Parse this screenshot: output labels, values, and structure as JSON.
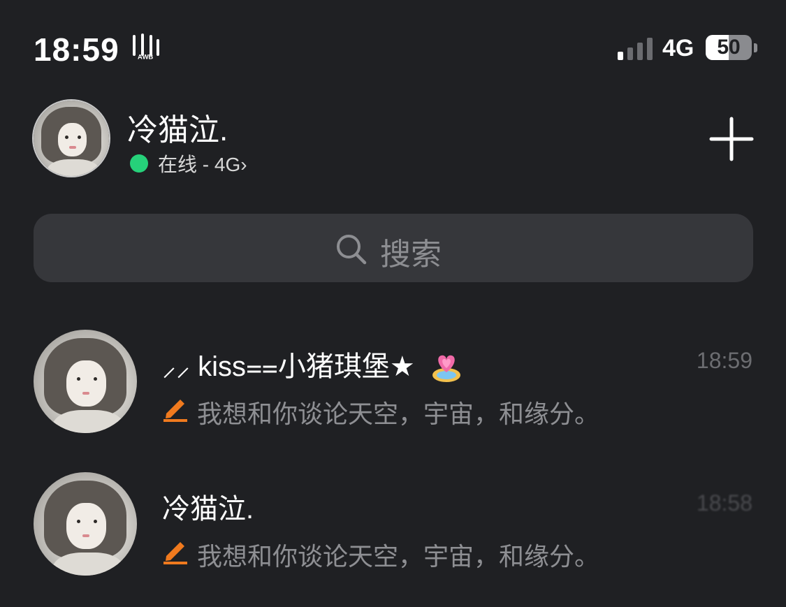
{
  "status_bar": {
    "time": "18:59",
    "network": "4G",
    "battery": "50",
    "battery_level": 50,
    "signal_bars": 1,
    "extra_icon": "tiktok-glyph-icon"
  },
  "profile": {
    "name": "冷猫泣.",
    "status": "在线 - 4G",
    "status_color": "#26d17a",
    "chevron": "›"
  },
  "search": {
    "placeholder": "搜索"
  },
  "chats": [
    {
      "name": "⸝⸝ kiss⩵小猪琪堡★",
      "time": "18:59",
      "preview": "我想和你谈论天空，宇宙，和缘分。",
      "badge_icon": "heart-gift-icon"
    },
    {
      "name": "冷猫泣.",
      "time": "18:58",
      "preview": "我想和你谈论天空，宇宙，和缘分。"
    }
  ],
  "colors": {
    "background": "#1f2023",
    "search_bg": "#36373b",
    "accent_orange": "#f07a1e",
    "online_green": "#26d17a"
  }
}
